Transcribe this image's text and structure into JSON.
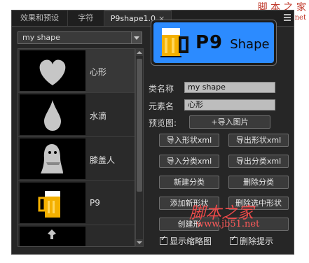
{
  "watermark": {
    "site_name": "脚 本 之 家",
    "url": "www.Jb51.net",
    "mid_name": "脚本之家",
    "mid_url": "www.jb51.net"
  },
  "tabs": [
    {
      "label": "效果和预设"
    },
    {
      "label": "字符"
    },
    {
      "label": "P9shape1.0"
    }
  ],
  "dropdown": {
    "value": "my shape"
  },
  "shapes": [
    {
      "label": "心形"
    },
    {
      "label": "水滴"
    },
    {
      "label": "膝盖人"
    },
    {
      "label": "P9"
    }
  ],
  "logo": {
    "text_p9": "P9",
    "text_shape": "Shape"
  },
  "fields": {
    "category_label": "类名称",
    "category_value": "my shape",
    "element_label": "元素名",
    "element_value": "心形",
    "preview_label": "预览图:"
  },
  "buttons": {
    "import_image": "+导入图片",
    "import_shape_xml": "导入形状xml",
    "export_shape_xml": "导出形状xml",
    "import_category_xml": "导入分类xml",
    "export_category_xml": "导出分类xml",
    "new_category": "新建分类",
    "delete_category": "删除分类",
    "add_new_shape": "添加新形状",
    "delete_selected_shape": "删除选中形状",
    "create_shape": "创建形"
  },
  "checkboxes": {
    "show_thumbnails": "显示缩略图",
    "delete_prompt": "删除提示"
  },
  "colors": {
    "accent_logo": "#2c8bff",
    "panel_bg": "#262626",
    "watermark": "#e24a4a"
  }
}
